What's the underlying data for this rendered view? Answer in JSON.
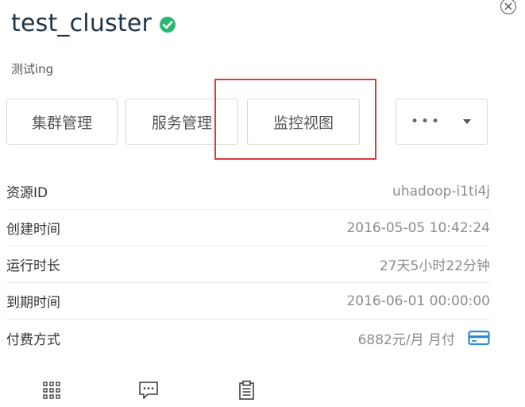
{
  "cluster": {
    "name": "test_cluster",
    "status_icon": "check-circle-icon",
    "status_color": "#2bb673",
    "description": "测试ing"
  },
  "actions": {
    "cluster_manage": "集群管理",
    "service_manage": "服务管理",
    "monitor_view": "监控视图",
    "more_label": "•••"
  },
  "details": [
    {
      "label": "资源ID",
      "value": "uhadoop-i1ti4j"
    },
    {
      "label": "创建时间",
      "value": "2016-05-05 10:42:24"
    },
    {
      "label": "运行时长",
      "value": "27天5小时22分钟"
    },
    {
      "label": "到期时间",
      "value": "2016-06-01 00:00:00"
    },
    {
      "label": "付费方式",
      "value": "6882元/月 月付"
    }
  ],
  "icons": {
    "close": "close-circle-icon",
    "card": "credit-card-icon",
    "grid": "grid-icon",
    "comment": "comment-icon",
    "clipboard": "clipboard-icon"
  },
  "colors": {
    "highlight": "#e03a3a",
    "card_icon": "#2b8ad8",
    "title": "#1f3347"
  }
}
